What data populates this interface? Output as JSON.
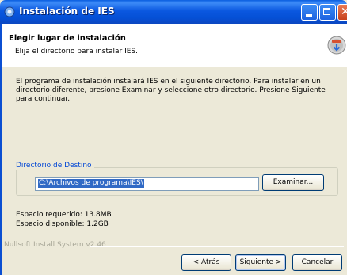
{
  "window": {
    "title": "Instalación de IES",
    "title_icon": "installer-icon"
  },
  "header": {
    "title": "Elegir lugar de instalación",
    "subtitle": "Elija el directorio para instalar IES."
  },
  "description": "El programa de instalación instalará IES en el siguiente directorio. Para instalar en un directorio diferente, presione Examinar y seleccione otro directorio. Presione Siguiente para continuar.",
  "destination": {
    "group_label": "Directorio de Destino",
    "path_value": "C:\\Archivos de programa\\IES\\",
    "browse_label": "Examinar..."
  },
  "space": {
    "required": "Espacio requerido: 13.8MB",
    "available": "Espacio disponible: 1.2GB"
  },
  "footer": {
    "branding": "Nullsoft Install System v2.46",
    "back_label": "< Atrás",
    "next_label": "Siguiente >",
    "cancel_label": "Cancelar"
  },
  "colors": {
    "titlebar": "#0550d6",
    "group_label": "#0046d5",
    "selection": "#316ac5"
  }
}
